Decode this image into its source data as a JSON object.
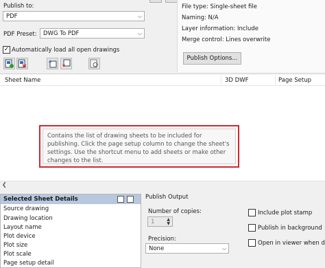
{
  "publish": {
    "publish_to_label": "Publish to:",
    "publish_to_value": "PDF",
    "preset_label": "PDF Preset:",
    "preset_value": "DWG To PDF",
    "auto_load_label": "Automatically load all open drawings",
    "auto_load_checked": true
  },
  "toolbar": {
    "icons": [
      "add-sheets-icon",
      "remove-sheets-icon",
      "move-up-icon",
      "move-down-icon",
      "preview-icon"
    ]
  },
  "info": {
    "file_type": "File type: Single-sheet file",
    "naming": "Naming: N/A",
    "layer_info": "Layer information: Include",
    "merge_control": "Merge control: Lines overwrite",
    "options_button": "Publish Options..."
  },
  "sheet_list": {
    "columns": [
      "Sheet Name",
      "3D DWF",
      "Page Setup"
    ],
    "tooltip": "Contains the list of drawing sheets to be included for publishing. Click the page setup column to change the sheet's settings. Use the shortcut menu to add sheets or make other changes to the list."
  },
  "details": {
    "title": "Selected Sheet Details",
    "rows": [
      "Source drawing",
      "Drawing location",
      "Layout name",
      "Plot device",
      "Plot size",
      "Plot scale",
      "Page setup detail"
    ]
  },
  "output": {
    "title": "Publish Output",
    "copies_label": "Number of copies:",
    "copies_value": "1",
    "precision_label": "Precision:",
    "precision_value": "None",
    "include_stamp": "Include plot stamp",
    "publish_bg": "Publish in background",
    "open_viewer": "Open in viewer when done"
  }
}
